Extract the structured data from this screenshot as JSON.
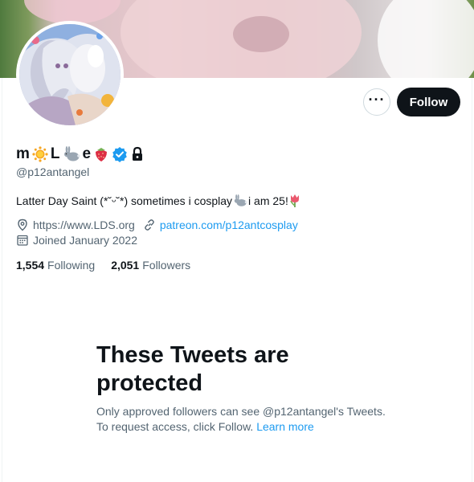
{
  "profile": {
    "name_parts": [
      "m",
      "L",
      "e"
    ],
    "handle": "@p12antangel",
    "bio_prefix": "Latter Day Saint (*˘ᵕ˘*) sometimes i cosplay",
    "bio_suffix": " i am 25!",
    "website": "https://www.LDS.org",
    "patreon": "patreon.com/p12antcosplay",
    "joined": "Joined January 2022",
    "following_count": "1,554",
    "following_label": "Following",
    "followers_count": "2,051",
    "followers_label": "Followers"
  },
  "actions": {
    "follow_label": "Follow",
    "more_label": "···"
  },
  "protected": {
    "title": "These Tweets are protected",
    "description": "Only approved followers can see @p12antangel's Tweets. To request access, click Follow. ",
    "learn_more": "Learn more"
  },
  "colors": {
    "accent": "#1d9bf0",
    "verified": "#1d9bf0",
    "follow_button": "#0f1419",
    "secondary_text": "#536471"
  },
  "icons": {
    "name": [
      "sun-emoji",
      "rabbit-emoji",
      "strawberry-emoji",
      "verified-badge-icon",
      "lock-icon"
    ],
    "bio": [
      "rabbit-emoji",
      "tulip-emoji"
    ],
    "meta": [
      "location-icon",
      "link-icon",
      "calendar-icon"
    ]
  }
}
